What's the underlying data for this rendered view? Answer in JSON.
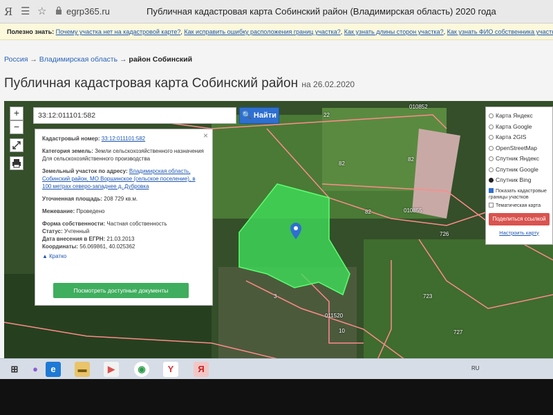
{
  "browser": {
    "url": "egrp365.ru",
    "title": "Публичная кадастровая карта Собинский район (Владимирская область) 2020 года"
  },
  "notice": {
    "lead": "Полезно знать:",
    "links": [
      "Почему участка нет на кадастровой карте?",
      "Как исправить ошибку расположения границ участка?",
      "Как узнать длины сторон участка?",
      "Как узнать ФИО собственника участка"
    ]
  },
  "breadcrumb": {
    "items": [
      "Россия",
      "Владимирская область"
    ],
    "current": "район Собинский",
    "separator": "→"
  },
  "page": {
    "title": "Публичная кадастровая карта Собинский район",
    "date": "на 26.02.2020"
  },
  "map": {
    "zoom_in": "+",
    "zoom_out": "−",
    "search_value": "33:12:011101:582",
    "search_button": "Найти",
    "labels": [
      "010852",
      "22",
      "82",
      "82",
      "82",
      "010855",
      "726",
      "723",
      "727",
      "3",
      "011520",
      "10"
    ]
  },
  "info": {
    "cadastral_label": "Кадастровый номер:",
    "cadastral_value": "33:12:011101:582",
    "category_label": "Категория земель:",
    "category_value": "Земли сельскохозяйственного назначения",
    "category_use": "Для сельскохозяйственного производства",
    "address_label": "Земельный участок по адресу:",
    "address_value": "Владимирская область, Собинский район, МО Воршинское (сельское поселение), в 100 метрах северо-западнее д. Дубровка",
    "area_label": "Уточненная площадь:",
    "area_value": "208 729 кв.м.",
    "survey_label": "Межевание:",
    "survey_value": "Проведено",
    "ownership_label": "Форма собственности:",
    "ownership_value": "Частная собственность",
    "status_label": "Статус:",
    "status_value": "Учтенный",
    "registered_label": "Дата внесения в ЕГРН:",
    "registered_value": "21.03.2013",
    "coords_label": "Координаты:",
    "coords_value": "56.069861, 40.025362",
    "collapse": "▲ Кратко",
    "docs_button": "Посмотреть доступные документы",
    "close": "×"
  },
  "layers": {
    "options": [
      {
        "label": "Карта Яндекс",
        "selected": false
      },
      {
        "label": "Карта Google",
        "selected": false
      },
      {
        "label": "Карта 2GIS",
        "selected": false
      },
      {
        "label": "OpenStreetMap",
        "selected": false
      },
      {
        "label": "Спутник Яндекс",
        "selected": false
      },
      {
        "label": "Спутник Google",
        "selected": false
      },
      {
        "label": "Спутник Bing",
        "selected": true
      }
    ],
    "show_borders": "Показать кадастровые границы участков",
    "thematic": "Тематическая карта",
    "share_button": "Поделиться ссылкой",
    "setup_link": "Настроить карту"
  },
  "taskbar": {
    "lang": "RU"
  },
  "colors": {
    "accent": "#2e6fd1",
    "parcel": "#3fe05a",
    "docs_button": "#3fae5e",
    "share_button": "#d9534f"
  }
}
